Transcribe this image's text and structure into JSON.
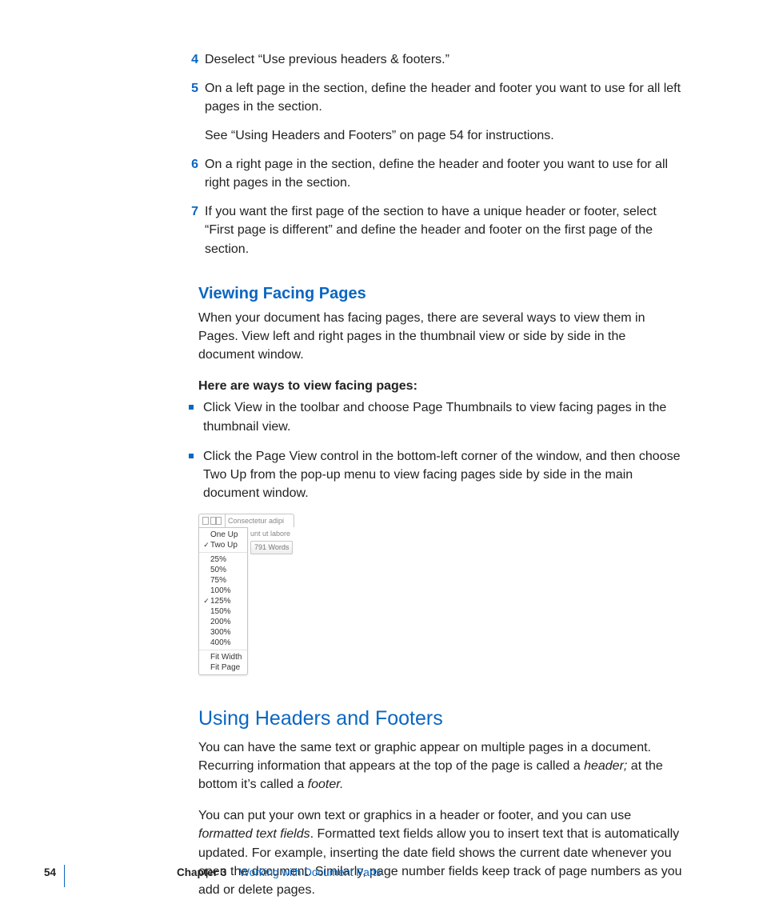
{
  "steps": [
    {
      "num": "4",
      "text": "Deselect “Use previous headers & footers.”"
    },
    {
      "num": "5",
      "text": "On a left page in the section, define the header and footer you want to use for all left pages in the section.",
      "sub": "See “Using Headers and Footers” on page 54 for instructions."
    },
    {
      "num": "6",
      "text": "On a right page in the section, define the header and footer you want to use for all right pages in the section."
    },
    {
      "num": "7",
      "text": "If you want the first page of the section to have a unique header or footer, select “First page is different” and define the header and footer on the first page of the section."
    }
  ],
  "viewing": {
    "title": "Viewing Facing Pages",
    "intro": "When your document has facing pages, there are several ways to view them in Pages. View left and right pages in the thumbnail view or side by side in the document window.",
    "bullets_intro": "Here are ways to view facing pages:",
    "bullets": [
      "Click View in the toolbar and choose Page Thumbnails to view facing pages in the thumbnail view.",
      "Click the Page View control in the bottom-left corner of the window, and then choose Two Up from the pop-up menu to view facing pages side by side in the main document window."
    ]
  },
  "popup": {
    "top_text": "Consectetur adipi",
    "side_text": "unt ut labore",
    "word_count": "791 Words",
    "groups": [
      {
        "items": [
          {
            "label": "One Up",
            "checked": false
          },
          {
            "label": "Two Up",
            "checked": true
          }
        ]
      },
      {
        "items": [
          {
            "label": "25%",
            "checked": false
          },
          {
            "label": "50%",
            "checked": false
          },
          {
            "label": "75%",
            "checked": false
          },
          {
            "label": "100%",
            "checked": false
          },
          {
            "label": "125%",
            "checked": true
          },
          {
            "label": "150%",
            "checked": false
          },
          {
            "label": "200%",
            "checked": false
          },
          {
            "label": "300%",
            "checked": false
          },
          {
            "label": "400%",
            "checked": false
          }
        ]
      },
      {
        "items": [
          {
            "label": "Fit Width",
            "checked": false
          },
          {
            "label": "Fit Page",
            "checked": false
          }
        ]
      }
    ]
  },
  "headers_section": {
    "title": "Using Headers and Footers",
    "p1_a": "You can have the same text or graphic appear on multiple pages in a document. Recurring information that appears at the top of the page is called a ",
    "p1_i1": "header;",
    "p1_b": " at the bottom it’s called a ",
    "p1_i2": "footer.",
    "p2_a": "You can put your own text or graphics in a header or footer, and you can use ",
    "p2_i1": "formatted text fields",
    "p2_b": ". Formatted text fields allow you to insert text that is automatically updated. For example, inserting the date field shows the current date whenever you open the document. Similarly, page number fields keep track of page numbers as you add or delete pages."
  },
  "footer": {
    "page": "54",
    "chapter_label": "Chapter 3",
    "chapter_title": "Working with Document Parts"
  }
}
